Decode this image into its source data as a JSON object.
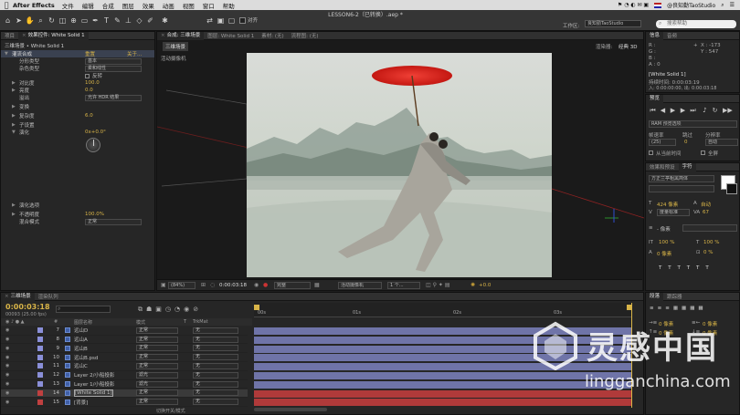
{
  "menubar": {
    "app_name": "After Effects",
    "items": [
      "文件",
      "编辑",
      "合成",
      "图层",
      "效果",
      "动画",
      "视图",
      "窗口",
      "帮助"
    ],
    "user": "@良知勤TaoStudio"
  },
  "document_title": "LESSON6-2（已转换）.aep *",
  "toolbar": {
    "snap_label": "对齐",
    "workspace_label": "工作区:",
    "workspace_value": "良知勤TaoStudio",
    "search_placeholder": "搜索帮助"
  },
  "effect_controls": {
    "tabs": [
      "项目",
      "效果控件: White Solid 1"
    ],
    "header": "三维场景 • White Solid 1",
    "rows": [
      {
        "name": "灌流合成",
        "value": "重置",
        "extra": "关于..."
      },
      {
        "name": "分形类型",
        "value": "基本"
      },
      {
        "name": "杂色类型",
        "value": "柔和线性"
      },
      {
        "name": "",
        "value": "反转"
      },
      {
        "name": "对比度",
        "value": "100.0"
      },
      {
        "name": "亮度",
        "value": "0.0"
      },
      {
        "name": "溢出",
        "value": "允许 HDR 结果"
      },
      {
        "name": "变换",
        "value": ""
      },
      {
        "name": "复杂度",
        "value": "6.0"
      },
      {
        "name": "子设置",
        "value": ""
      },
      {
        "name": "演化",
        "value": "0x+0.0°"
      },
      {
        "name": "演化选项",
        "value": ""
      },
      {
        "name": "不透明度",
        "value": "100.0%"
      },
      {
        "name": "混合模式",
        "value": "正常"
      }
    ]
  },
  "composition": {
    "tabs": [
      "合成: 三维场景",
      "图层: White Solid 1",
      "素材: (无)",
      "流程图: (无)"
    ],
    "sub_tab": "三维场景",
    "camera_label": "活动摄像机",
    "renderer_label": "渲染器:",
    "renderer_value": "经典 3D",
    "footer": {
      "zoom": "(84%)",
      "timecode": "0:00:03:18",
      "quality": "完整",
      "view": "活动摄像机",
      "views": "1 个...",
      "offset": "+0.0"
    }
  },
  "info_panel": {
    "tabs": [
      "信息",
      "音频"
    ],
    "r": "R :",
    "g": "G :",
    "b": "B :",
    "a": "A : 0",
    "x": "X : -173",
    "y": "Y : 547",
    "layer_name": "[White Solid 1]",
    "duration": "持续时间: 0:00:03:19",
    "in_out": "入: 0:00:00:00, 出: 0:00:03:18"
  },
  "preview_panel": {
    "tab": "预览",
    "ram_label": "RAM 预览选项",
    "frame_rate_label": "帧速率",
    "skip_label": "跳过",
    "resolution_label": "分辨率",
    "frame_rate": "(25)",
    "skip": "0",
    "resolution": "自动",
    "from_current": "从当前时间",
    "fullscreen": "全屏"
  },
  "character_panel": {
    "tabs": [
      "效果和预设",
      "字符"
    ],
    "font": "方正兰亭粗黑简体",
    "size": "424 像素",
    "leading": "自动",
    "kerning": "度量标准",
    "tracking": "67",
    "stroke": "- 像素",
    "vscale": "100 %",
    "hscale": "100 %",
    "baseline": "0 像素",
    "tsume": "0 %"
  },
  "paragraph_panel": {
    "tabs": [
      "段落",
      "跟踪器"
    ],
    "indent_left": "0 像素",
    "indent_right": "0 像素",
    "space_before": "0 像素",
    "space_after": "0 像素"
  },
  "timeline": {
    "tabs": [
      "三维场景",
      "渲染队列"
    ],
    "timecode": "0:00:03:18",
    "fps": "00093 (25.00 fps)",
    "columns": {
      "num": "#",
      "name": "图层名称",
      "mode": "模式",
      "t": "T",
      "trkmat": "TrkMat"
    },
    "ruler": [
      "00s",
      "01s",
      "02s",
      "03s"
    ],
    "footer_label": "切换开关/模式",
    "layers": [
      {
        "num": "7",
        "name": "远山D",
        "mode": "正常",
        "trk": "无",
        "color": "#8a8fd8"
      },
      {
        "num": "8",
        "name": "远山A",
        "mode": "正常",
        "trk": "无",
        "color": "#8a8fd8"
      },
      {
        "num": "9",
        "name": "远山B",
        "mode": "正常",
        "trk": "无",
        "color": "#8a8fd8"
      },
      {
        "num": "10",
        "name": "远山B.psd",
        "mode": "正常",
        "trk": "无",
        "color": "#8a8fd8"
      },
      {
        "num": "11",
        "name": "远山C",
        "mode": "正常",
        "trk": "无",
        "color": "#8a8fd8"
      },
      {
        "num": "12",
        "name": "Layer 2/小船投影",
        "mode": "滤光",
        "trk": "无",
        "color": "#8a8fd8"
      },
      {
        "num": "13",
        "name": "Layer 1/小船投影",
        "mode": "滤光",
        "trk": "无",
        "color": "#8a8fd8"
      },
      {
        "num": "14",
        "name": "[White Solid 1]",
        "mode": "正常",
        "trk": "无",
        "color": "#c04040"
      },
      {
        "num": "15",
        "name": "[背景]",
        "mode": "正常",
        "trk": "无",
        "color": "#c04040"
      }
    ]
  },
  "watermark": {
    "cn": "灵感中国",
    "en": "lingganchina.com"
  },
  "colors": {
    "accent": "#d8b448",
    "timeline_bar": "#6f74a8",
    "selected_bar": "#b03a3a",
    "umbrella": "#d8231e"
  }
}
